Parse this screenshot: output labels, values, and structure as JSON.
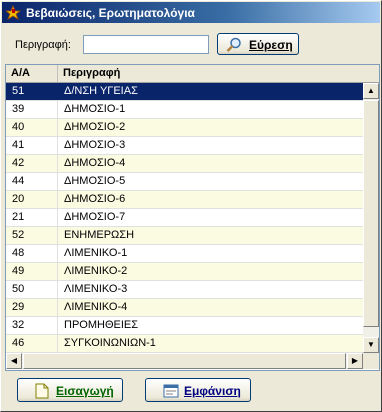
{
  "window": {
    "title": "Βεβαιώσεις, Ερωτηματολόγια"
  },
  "search": {
    "label": "Περιγραφή:",
    "value": "",
    "button_label": "Εύρεση"
  },
  "table": {
    "columns": [
      "Α/Α",
      "Περιγραφή"
    ],
    "selected_index": 0,
    "rows": [
      {
        "id": "51",
        "desc": "Δ/ΝΣΗ ΥΓΕΙΑΣ"
      },
      {
        "id": "39",
        "desc": "ΔΗΜΟΣΙΟ-1"
      },
      {
        "id": "40",
        "desc": "ΔΗΜΟΣΙΟ-2"
      },
      {
        "id": "41",
        "desc": "ΔΗΜΟΣΙΟ-3"
      },
      {
        "id": "42",
        "desc": "ΔΗΜΟΣΙΟ-4"
      },
      {
        "id": "44",
        "desc": "ΔΗΜΟΣΙΟ-5"
      },
      {
        "id": "20",
        "desc": "ΔΗΜΟΣΙΟ-6"
      },
      {
        "id": "21",
        "desc": "ΔΗΜΟΣΙΟ-7"
      },
      {
        "id": "52",
        "desc": "ΕΝΗΜΕΡΩΣΗ"
      },
      {
        "id": "48",
        "desc": "ΛΙΜΕΝΙΚΟ-1"
      },
      {
        "id": "49",
        "desc": "ΛΙΜΕΝΙΚΟ-2"
      },
      {
        "id": "50",
        "desc": "ΛΙΜΕΝΙΚΟ-3"
      },
      {
        "id": "29",
        "desc": "ΛΙΜΕΝΙΚΟ-4"
      },
      {
        "id": "32",
        "desc": "ΠΡΟΜΗΘΕΙΕΣ"
      },
      {
        "id": "46",
        "desc": "ΣΥΓΚΟΙΝΩΝΙΩΝ-1"
      }
    ]
  },
  "actions": {
    "insert_label": "Εισαγωγή",
    "view_label": "Εμφάνιση"
  },
  "colors": {
    "selection": "#0a246a",
    "row_alt": "#fbfbe2",
    "title_bar": "#0a246a"
  },
  "icons": {
    "app": "app-logo-icon",
    "search": "magnifier-icon",
    "insert": "new-document-icon",
    "view": "view-document-icon"
  }
}
